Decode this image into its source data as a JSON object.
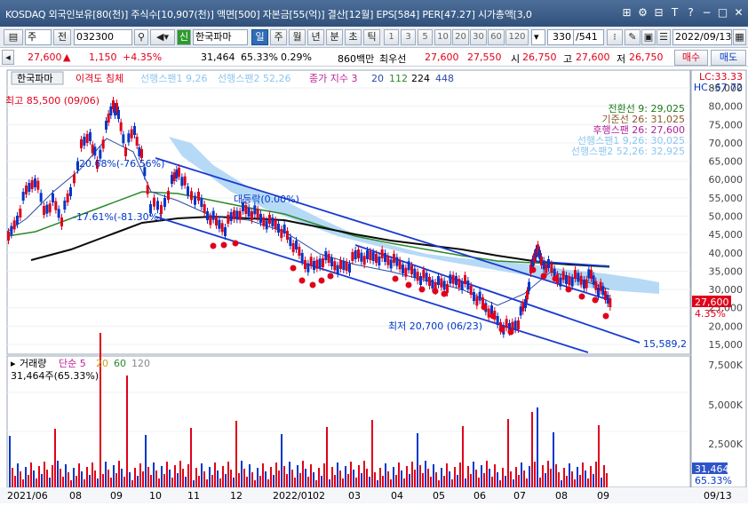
{
  "title_bar": {
    "title": "KOSDAQ 외국인보유[80(천)] 주식수[10,907(천)] 액면[500] 자본금[55(억)] 결산[12월] EPS[584] PER[47.27] 시가총액[3,0"
  },
  "toolbar": {
    "market": "주",
    "prev": "전",
    "code": "032300",
    "stock_badge": "신",
    "stock_name": "한국파마",
    "periods": [
      "일",
      "주",
      "월",
      "년",
      "분",
      "초",
      "틱"
    ],
    "intervals": [
      "1",
      "3",
      "5",
      "10",
      "20",
      "30",
      "60",
      "120"
    ],
    "count": "330",
    "total": "/541",
    "date": "2022/09/13"
  },
  "price_bar": {
    "price": "27,600",
    "change_arrow": "▲",
    "change": "1,150",
    "change_pct": "+4.35%",
    "volume": "31,464",
    "vol_pct": "65.33%",
    "turnover": "0.29%",
    "amount": "860백만",
    "best_label": "최우선",
    "ask": "27,600",
    "bid": "27,550",
    "open_label": "시",
    "open": "26,750",
    "high_label": "고",
    "high": "27,600",
    "low_label": "저",
    "low": "26,750",
    "buy_btn": "매수",
    "sell_btn": "매도"
  },
  "price_panel": {
    "stock_name": "한국파마",
    "indicator_label": "이격도 침체",
    "ichimoku_legend": "선행스팬1 9,26",
    "ichimoku_legend2": "선행스팬2 52,26",
    "ma_label": "종가 지수 3",
    "ma_periods": [
      "20",
      "112",
      "224",
      "448"
    ],
    "lc": "LC:33.33",
    "hc": "HC:-67.72",
    "max_label": "최고 85,500 (09/06)",
    "min_label": "최저 20,700 (06/23)",
    "annot_1": "-20.68%(-76.56%)",
    "annot_2": "-17.61%(-81.30%)",
    "annot_3": "대등락(0.00%)",
    "trend_label": "15,589,2",
    "info_lines": [
      "전환선 9: 29,025",
      "기준선 26: 31,025",
      "후행스팬 26: 27,600",
      "선행스팬1 9,26: 30,025",
      "선행스팬2 52,26: 32,925"
    ],
    "current_price_tag": "27,600",
    "current_pct_tag": "4.35%",
    "y_ticks": [
      "85,000",
      "80,000",
      "75,000",
      "70,000",
      "65,000",
      "60,000",
      "55,000",
      "50,000",
      "45,000",
      "40,000",
      "35,000",
      "30,000",
      "25,000",
      "20,000",
      "15,000"
    ]
  },
  "volume_panel": {
    "label": "거래량",
    "ma_label": "단순 5",
    "ma_periods": [
      "20",
      "60",
      "120"
    ],
    "current": "31,464주(65.33%)",
    "y_ticks": [
      "7,500K",
      "5,000K",
      "2,500K"
    ],
    "current_tag": "31,464",
    "current_pct_tag": "65.33%"
  },
  "x_axis": {
    "labels": [
      "2021/06",
      "08",
      "09",
      "10",
      "11",
      "12",
      "2022/01",
      "02",
      "03",
      "04",
      "05",
      "06",
      "07",
      "08",
      "09"
    ],
    "end_label": "09/13"
  },
  "colors": {
    "up": "#e0001b",
    "down": "#0037c8",
    "cloud": "#a9d4f5",
    "ma20": "#2a8a2a",
    "ma112": "#0a0a0a",
    "ma_blue": "#2a4aa8"
  }
}
